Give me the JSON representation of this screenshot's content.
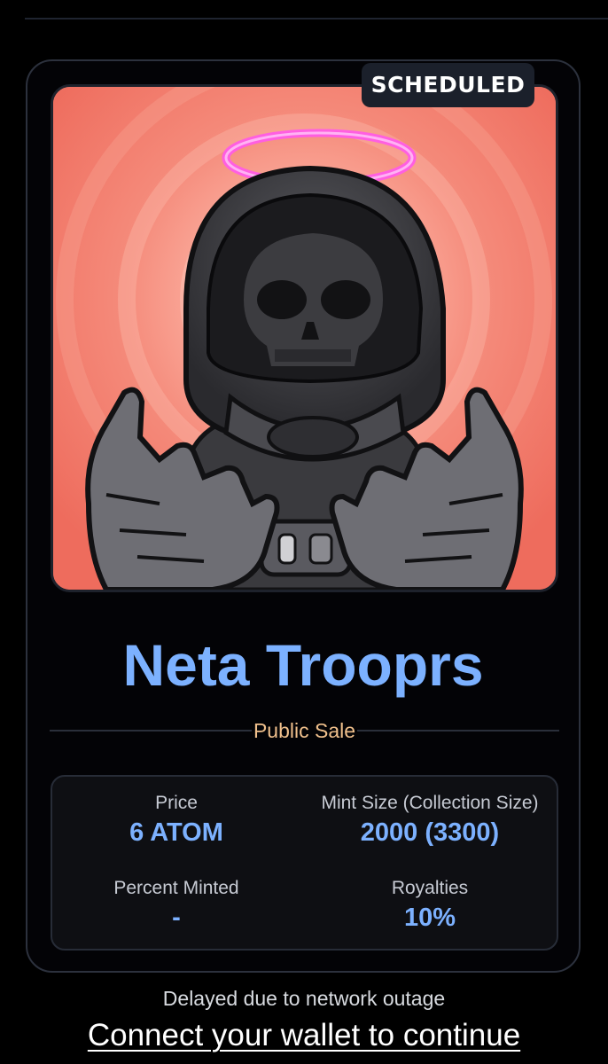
{
  "badge": {
    "status": "SCHEDULED"
  },
  "collection": {
    "title": "Neta Trooprs",
    "phase": "Public Sale",
    "artwork_icon": "haloed-skull-astronaut-icon"
  },
  "stats": {
    "price": {
      "label": "Price",
      "value": "6 ATOM"
    },
    "mint_size": {
      "label": "Mint Size (Collection Size)",
      "value": "2000 (3300)"
    },
    "percent_minted": {
      "label": "Percent Minted",
      "value": "-"
    },
    "royalties": {
      "label": "Royalties",
      "value": "10%"
    }
  },
  "footer": {
    "delay_note": "Delayed due to network outage",
    "connect_label": "Connect your wallet to continue"
  },
  "colors": {
    "accent": "#7cb1ff",
    "phase": "#f0c08c",
    "artwork_bg": "#f07a6b",
    "halo": "#ff5ce6"
  }
}
